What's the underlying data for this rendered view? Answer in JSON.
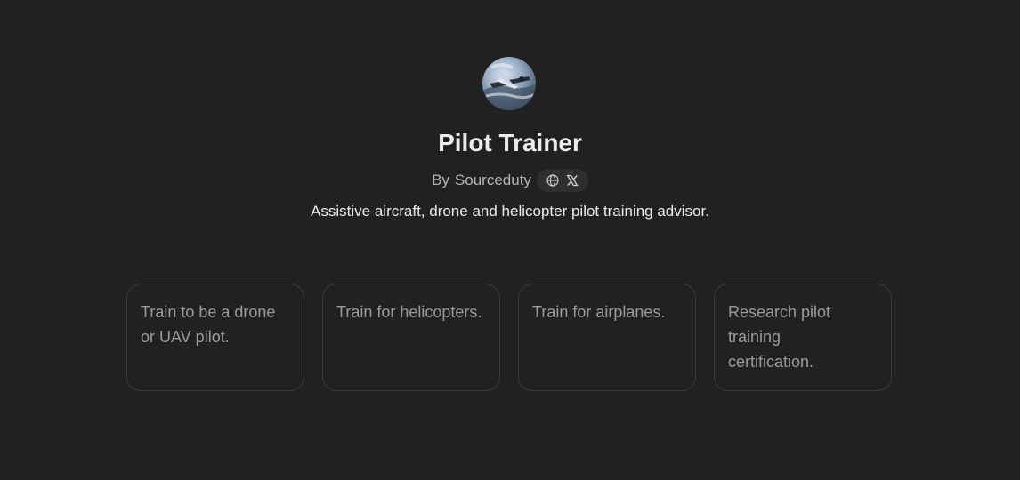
{
  "gpt": {
    "name": "Pilot Trainer",
    "author_prefix": "By",
    "author": "Sourceduty",
    "description": "Assistive aircraft, drone and helicopter pilot training advisor.",
    "social_icons": [
      "globe-icon",
      "x-icon"
    ]
  },
  "conversation_starters": [
    {
      "label": "Train to be a drone or UAV pilot."
    },
    {
      "label": "Train for helicopters."
    },
    {
      "label": "Train for airplanes."
    },
    {
      "label": "Research pilot training certification."
    }
  ],
  "colors": {
    "background": "#212121",
    "title": "#ececec",
    "muted": "#b4b4b4",
    "card_border": "#3a3a3a",
    "card_text": "#9b9b9b",
    "pill_bg": "#2f2f2f"
  }
}
